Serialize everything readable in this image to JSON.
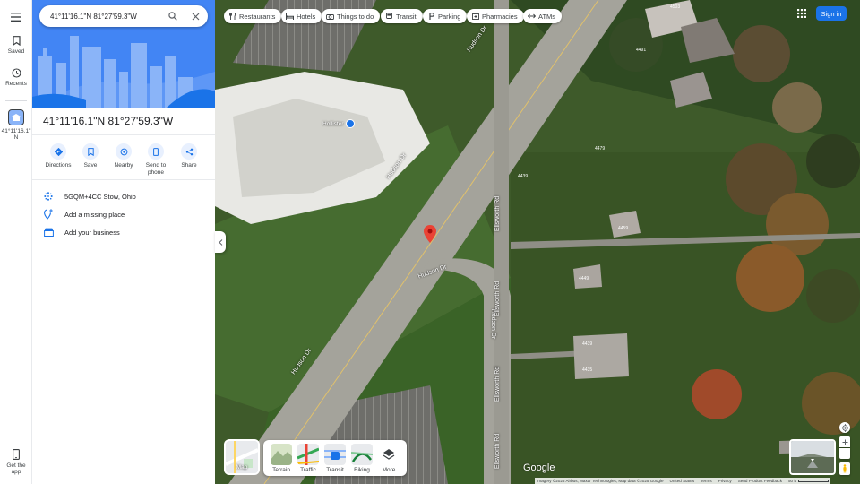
{
  "search": {
    "value": "41°11'16.1\"N 81°27'59.3\"W"
  },
  "rail": {
    "saved": "Saved",
    "recents": "Recents",
    "place_label_1": "41°11'16.1\"",
    "place_label_2": "N",
    "get_app_1": "Get the",
    "get_app_2": "app"
  },
  "place": {
    "title": "41°11'16.1\"N 81°27'59.3\"W",
    "actions": {
      "directions": "Directions",
      "save": "Save",
      "nearby": "Nearby",
      "send_1": "Send to",
      "send_2": "phone",
      "share": "Share"
    },
    "plus_code": "5GQM+4CC Stow, Ohio",
    "add_place": "Add a missing place",
    "add_business": "Add your business"
  },
  "chips": [
    "Restaurants",
    "Hotels",
    "Things to do",
    "Transit",
    "Parking",
    "Pharmacies",
    "ATMs"
  ],
  "signin": "Sign in",
  "layers": {
    "current": "Map",
    "options": [
      "Terrain",
      "Traffic",
      "Transit",
      "Biking",
      "More"
    ]
  },
  "map_labels": {
    "road": "Hudson Dr",
    "road2": "Ellsworth Rd",
    "store": "Hollister",
    "nums": [
      "4491",
      "4503",
      "4479",
      "4439",
      "4459",
      "4449",
      "4439",
      "4435"
    ]
  },
  "footer": {
    "logo": "Google",
    "imagery": "Imagery ©2025 Airbus, Maxar Technologies, Map data ©2025 Google",
    "country": "United States",
    "terms": "Terms",
    "privacy": "Privacy",
    "feedback": "Send Product Feedback",
    "scale": "50 ft"
  },
  "colors": {
    "accent": "#1a73e8",
    "pin": "#ea4335"
  }
}
